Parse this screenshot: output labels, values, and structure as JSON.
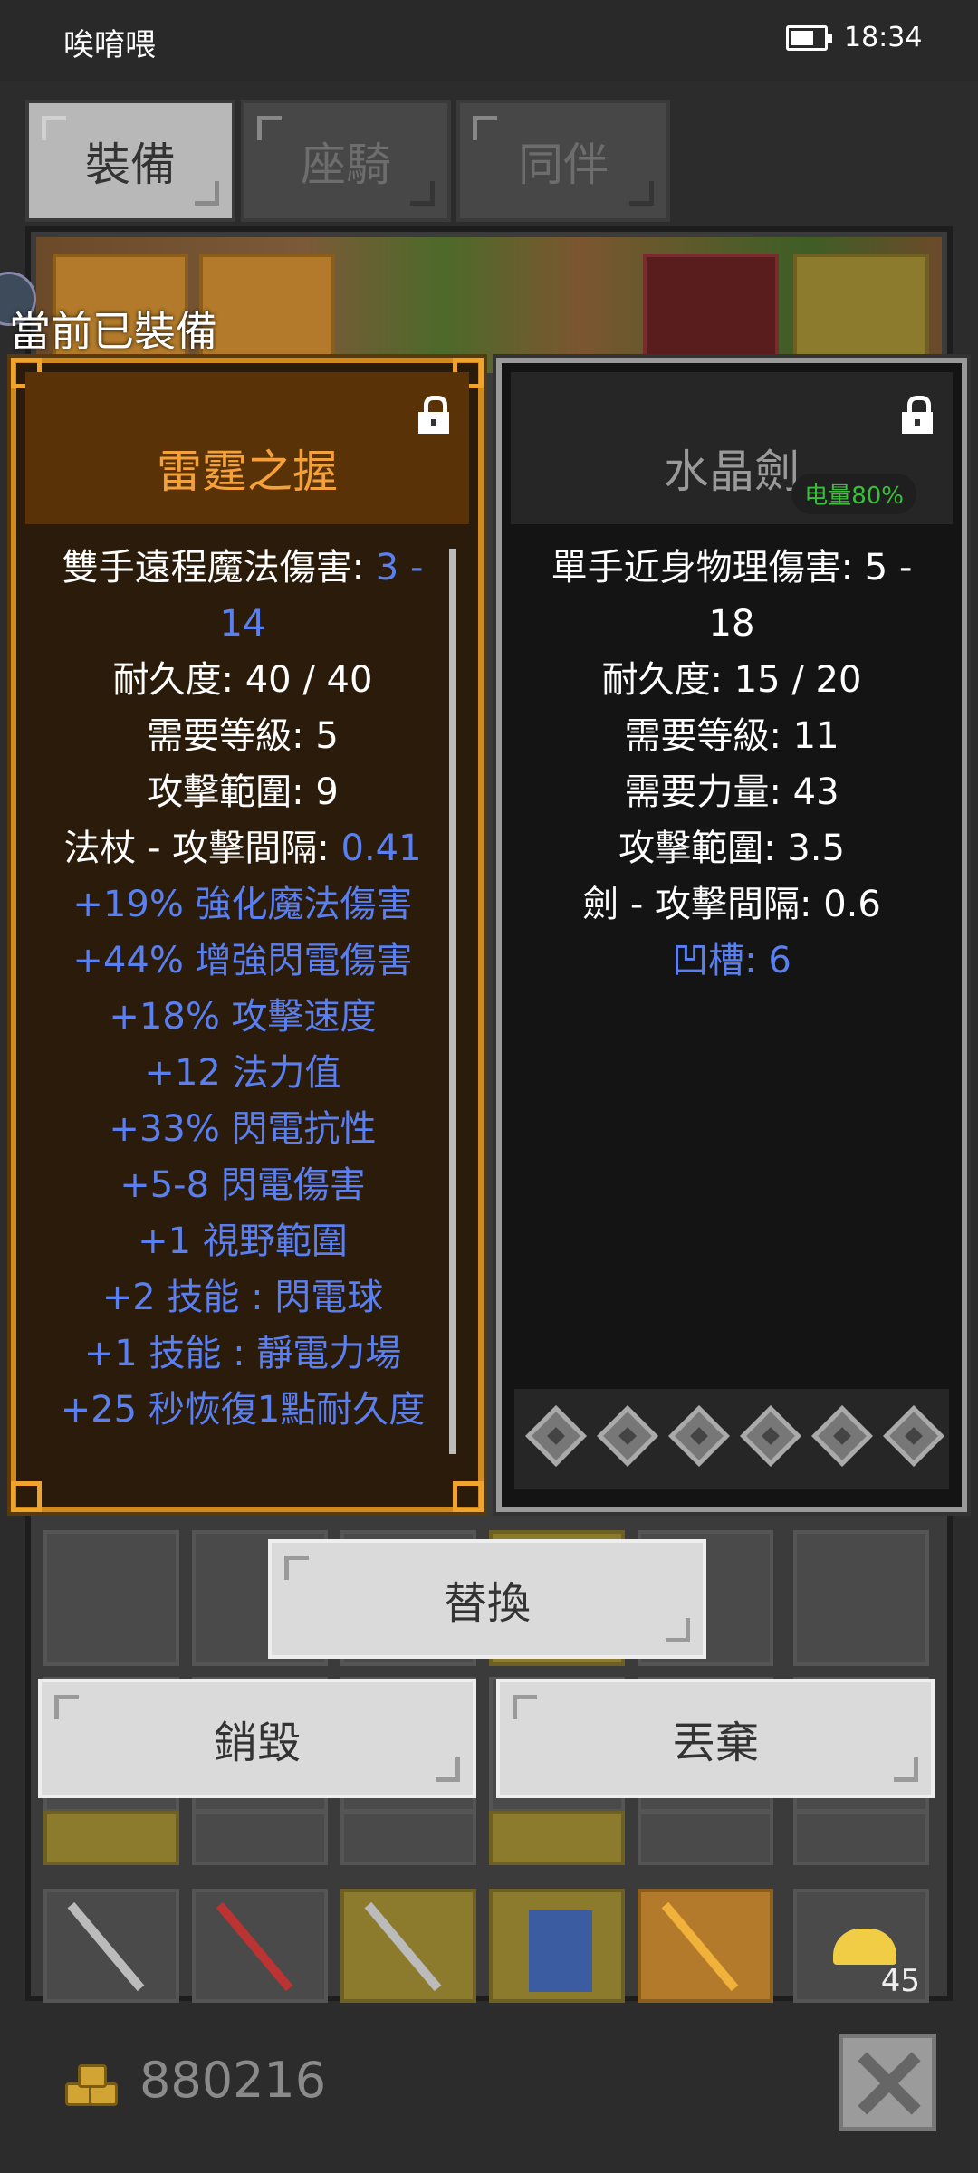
{
  "status_bar": {
    "carrier": "唉唷喂",
    "time": "18:34",
    "battery_level": 0.7
  },
  "tabs": [
    {
      "label": "裝備",
      "active": true
    },
    {
      "label": "座騎",
      "active": false
    },
    {
      "label": "同伴",
      "active": false
    }
  ],
  "equipped_label": "當前已裝備",
  "left_item": {
    "name": "雷霆之握",
    "lines": [
      {
        "text": "雙手遠程魔法傷害: ",
        "value": "3 -"
      },
      {
        "text": "",
        "value": "14"
      },
      {
        "text": "耐久度: 40 / 40"
      },
      {
        "text": "需要等級: 5"
      },
      {
        "text": "攻擊範圍: 9"
      },
      {
        "text": "法杖 - 攻擊間隔: ",
        "value": "0.41"
      },
      {
        "affix": "+19% 強化魔法傷害"
      },
      {
        "affix": "+44% 增強閃電傷害"
      },
      {
        "affix": "+18% 攻擊速度"
      },
      {
        "affix": "+12 法力值"
      },
      {
        "affix": "+33% 閃電抗性"
      },
      {
        "affix": "+5-8 閃電傷害"
      },
      {
        "affix": "+1 視野範圍"
      },
      {
        "affix": "+2 技能 : 閃電球"
      },
      {
        "affix": "+1 技能 : 靜電力場"
      },
      {
        "affix": "+25 秒恢復1點耐久度"
      }
    ]
  },
  "right_item": {
    "name": "水晶劍",
    "durability_badge": "电量80%",
    "lines": [
      {
        "text": "單手近身物理傷害: 5 -"
      },
      {
        "text": "18"
      },
      {
        "text": "耐久度: 15 / 20"
      },
      {
        "text": "需要等級: 11"
      },
      {
        "text": "需要力量: 43"
      },
      {
        "text": "攻擊範圍: 3.5"
      },
      {
        "text": "劍 - 攻擊間隔: 0.6"
      },
      {
        "affix": "凹槽: 6"
      }
    ],
    "sockets": 6
  },
  "buttons": {
    "replace": "替換",
    "destroy": "銷毀",
    "discard": "丟棄"
  },
  "gold": "880216",
  "inventory_stack_count": "45"
}
